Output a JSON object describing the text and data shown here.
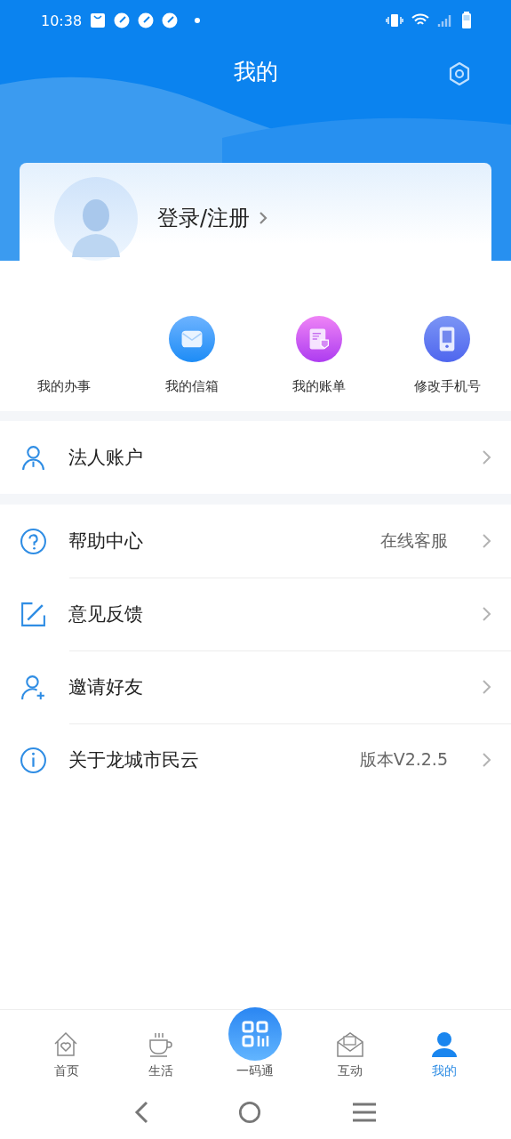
{
  "status_bar": {
    "time": "10:38"
  },
  "header": {
    "title": "我的"
  },
  "profile": {
    "login_label": "登录/注册"
  },
  "shortcuts": [
    {
      "label": "我的办事"
    },
    {
      "label": "我的信箱"
    },
    {
      "label": "我的账单"
    },
    {
      "label": "修改手机号"
    }
  ],
  "menu_groups": [
    {
      "items": [
        {
          "label": "法人账户"
        }
      ]
    },
    {
      "items": [
        {
          "label": "帮助中心",
          "value": "在线客服"
        },
        {
          "label": "意见反馈"
        },
        {
          "label": "邀请好友"
        },
        {
          "label": "关于龙城市民云",
          "value": "版本V2.2.5"
        }
      ]
    }
  ],
  "tabs": [
    {
      "label": "首页",
      "selected": false
    },
    {
      "label": "生活",
      "selected": false
    },
    {
      "label": "一码通",
      "selected": false
    },
    {
      "label": "互动",
      "selected": false
    },
    {
      "label": "我的",
      "selected": true
    }
  ]
}
